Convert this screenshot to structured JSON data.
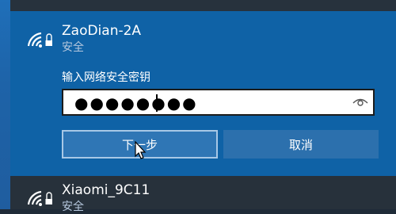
{
  "active_network": {
    "name": "ZaoDian-2A",
    "status": "安全",
    "icon": "wifi-signal-icon"
  },
  "security_key": {
    "label": "输入网络安全密钥",
    "value": "●●●●●●●●",
    "reveal_icon": "eye-icon"
  },
  "buttons": {
    "next_label": "下一步",
    "cancel_label": "取消"
  },
  "other_network": {
    "name": "Xiaomi_9C11",
    "status": "安全",
    "icon": "wifi-signal-icon"
  },
  "colors": {
    "flyout_bg": "#0f62a6",
    "button_bg": "#2c70ad",
    "focused_border": "#a8c8e6"
  }
}
